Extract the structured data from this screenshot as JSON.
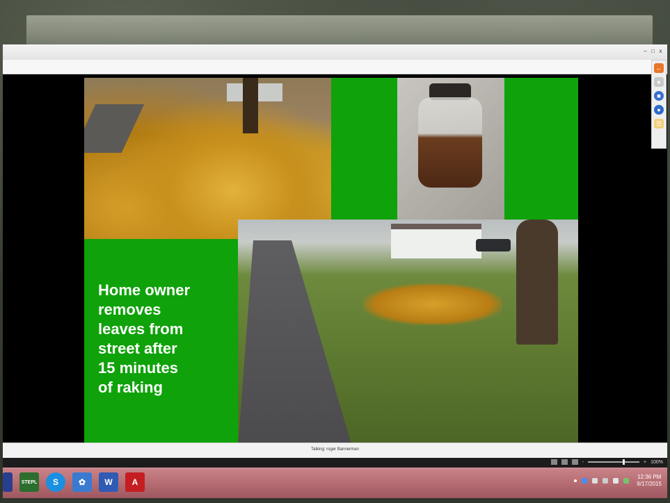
{
  "slide": {
    "caption": "Home owner\nremoves\nleaves from\nstreet after\n15 minutes\nof raking"
  },
  "status": {
    "talking": "Talking: roger Bannerman"
  },
  "zoom": {
    "minus": "-",
    "plus": "+",
    "level": "100%"
  },
  "taskbar": {
    "steps_label": "STEPL",
    "skype_label": "S",
    "word_label": "W",
    "acrobat_label": "A"
  },
  "clock": {
    "time": "12:36 PM",
    "date": "9/17/2015"
  },
  "window": {
    "min": "–",
    "max": "□",
    "close": "x"
  },
  "colors": {
    "slide_green": "#0fa20a",
    "taskbar": "#b36a70"
  }
}
